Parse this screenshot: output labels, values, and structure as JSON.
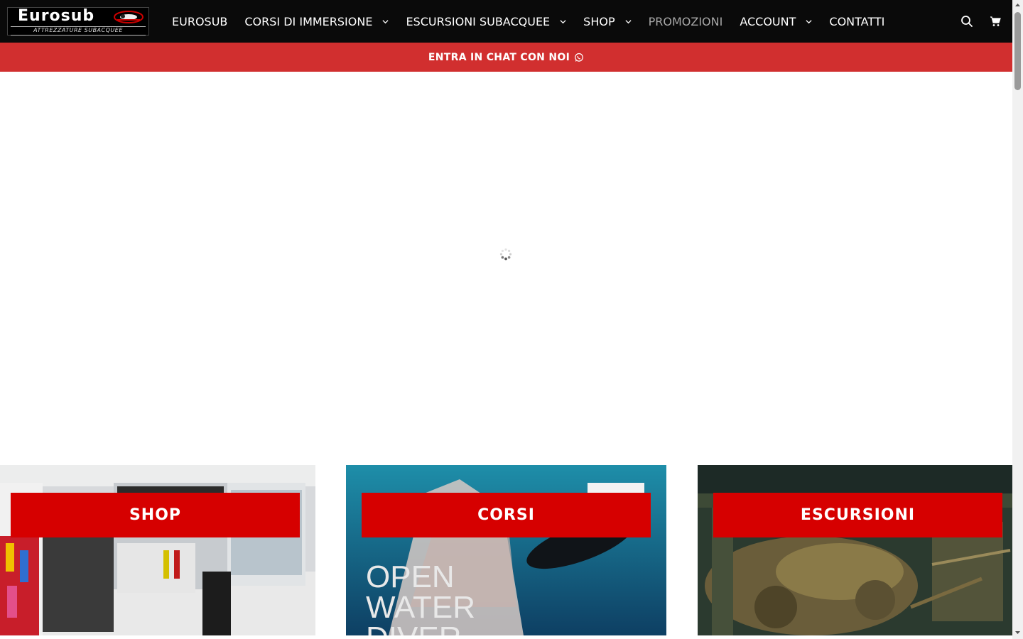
{
  "header": {
    "logo": {
      "title": "Eurosub",
      "subtitle": "ATTREZZATURE SUBACQUEE"
    },
    "nav": [
      {
        "label": "EUROSUB",
        "has_dropdown": false,
        "muted": false
      },
      {
        "label": "CORSI DI IMMERSIONE",
        "has_dropdown": true,
        "muted": false
      },
      {
        "label": "ESCURSIONI SUBACQUEE",
        "has_dropdown": true,
        "muted": false
      },
      {
        "label": "SHOP",
        "has_dropdown": true,
        "muted": false
      },
      {
        "label": "PROMOZIONI",
        "has_dropdown": false,
        "muted": true
      },
      {
        "label": "ACCOUNT",
        "has_dropdown": true,
        "muted": false
      },
      {
        "label": "CONTATTI",
        "has_dropdown": false,
        "muted": false
      }
    ],
    "icons": [
      "search-icon",
      "cart-icon"
    ]
  },
  "chat_bar": {
    "label": "ENTRA IN CHAT CON NOI",
    "icon": "whatsapp-icon"
  },
  "cards": [
    {
      "label": "SHOP",
      "image": "dive-shop-interior"
    },
    {
      "label": "CORSI",
      "image": "open-water-diver-course",
      "overlay_text": [
        "OPEN",
        "WATER",
        "DIVER"
      ]
    },
    {
      "label": "ESCURSIONI",
      "image": "shipwreck-motorcycles"
    }
  ],
  "colors": {
    "header_bg": "#0a0a0a",
    "chat_bar": "#d12f2f",
    "card_button": "#d60000",
    "nav_muted": "#a8a8a8"
  }
}
